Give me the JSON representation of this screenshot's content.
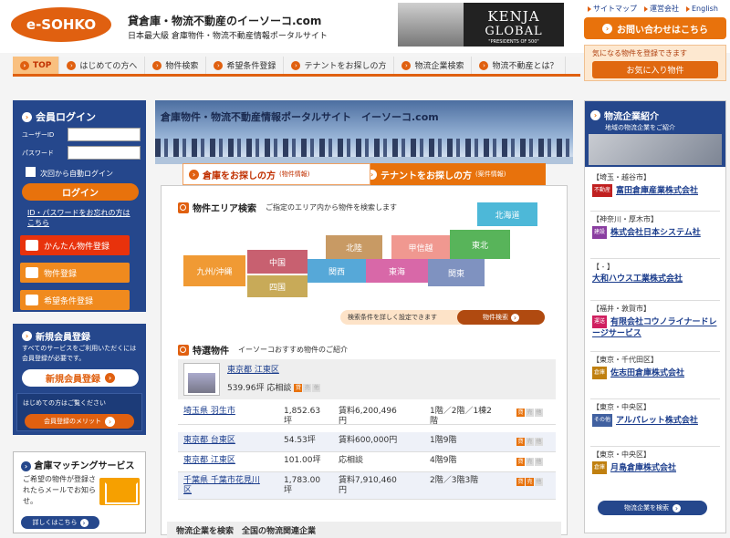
{
  "header": {
    "logo": "e-SOHKO",
    "title": "貸倉庫・物流不動産のイーソーコ.com",
    "subtitle": "日本最大級 倉庫物件・物流不動産情報ポータルサイト",
    "banner": {
      "line1": "KENJA",
      "line2": "GLOBAL",
      "line3": "\"PRESIDENTS OF 500\""
    },
    "toplinks": [
      "サイトマップ",
      "運営会社",
      "English"
    ],
    "contact": "お問い合わせはこちら",
    "fav_note": "気になる物件を登録できます",
    "fav_btn": "お気に入り物件"
  },
  "nav": [
    "TOP",
    "はじめての方へ",
    "物件検索",
    "希望条件登録",
    "テナントをお探しの方",
    "物流企業検索",
    "物流不動産とは？"
  ],
  "login": {
    "title": "会員ログイン",
    "user_label": "ユーザーID",
    "pass_label": "パスワード",
    "auto": "次回から自動ログイン",
    "button": "ログイン",
    "forgot": "ID・パスワードをお忘れの方はこちら"
  },
  "quick": [
    "かんたん物件登録",
    "物件登録",
    "希望条件登録"
  ],
  "register": {
    "title": "新規会員登録",
    "desc": "すべてのサービスをご利用いただくには会員登録が必要です。",
    "button": "新規会員登録",
    "first": "はじめての方はご覧ください",
    "merit": "会員登録のメリット"
  },
  "matching": {
    "title": "倉庫マッチングサービス",
    "desc": "ご希望の物件が登録されたらメールでお知らせ。",
    "button": "詳しくはこちら"
  },
  "hero": {
    "title": "倉庫物件・物流不動産情報ポータルサイト　イーソーコ.com"
  },
  "tabs": {
    "tab1": "倉庫をお探しの方",
    "tab1_small": "(物件情報)",
    "tab2": "テナントをお探しの方",
    "tab2_small": "(案件情報)"
  },
  "area": {
    "title": "物件エリア検索",
    "desc": "ご指定のエリア内から物件を検索します",
    "regions": [
      "北海道",
      "東北",
      "北陸",
      "甲信越",
      "中国",
      "関西",
      "東海",
      "関東",
      "九州/沖縄",
      "四国"
    ],
    "detail": "検索条件を詳しく設定できます",
    "button": "物件検索"
  },
  "featured": {
    "title": "特選物件",
    "desc": "イーソーコおすすめ物件のご紹介",
    "addr": "東京都 江東区",
    "area": "539.96坪 応相談"
  },
  "rows": [
    {
      "addr": "埼玉県 羽生市",
      "area": "1,852.63\n坪",
      "price": "賃料6,200,496\n円",
      "floor": "1階／2階／1棟2\n階"
    },
    {
      "addr": "東京都 台東区",
      "area": "54.53坪",
      "price": "賃料600,000円",
      "floor": "1階9階"
    },
    {
      "addr": "東京都 江東区",
      "area": "101.00坪",
      "price": "応相談",
      "floor": "4階9階"
    },
    {
      "addr": "千葉県 千葉市花見川\n区",
      "area": "1,783.00\n坪",
      "price": "賃料7,910,460\n円",
      "floor": "2階／3階3階"
    }
  ],
  "bottom": "物流企業を検索　全国の物流関連企業",
  "right": {
    "title": "物流企業紹介",
    "sub": "地域の物流企業をご紹介",
    "button": "物流企業を検索",
    "companies": [
      {
        "region": "【埼玉・越谷市】",
        "tag": "不動産",
        "tagcolor": "#c02020",
        "name": "富田倉庫産業株式会社"
      },
      {
        "region": "【神奈川・厚木市】",
        "tag": "建設",
        "tagcolor": "#8a3ea0",
        "name": "株式会社日本システム社"
      },
      {
        "region": "【 - 】",
        "tag": "",
        "tagcolor": "#ffffff",
        "name": "大和ハウス工業株式会社"
      },
      {
        "region": "【福井・敦賀市】",
        "tag": "運送",
        "tagcolor": "#d02060",
        "name": "有限会社コウノライナードレージサービス"
      },
      {
        "region": "【東京・千代田区】",
        "tag": "倉庫",
        "tagcolor": "#c08010",
        "name": "佐志田倉庫株式会社"
      },
      {
        "region": "【東京・中央区】",
        "tag": "その他",
        "tagcolor": "#4060a0",
        "name": "アルパレット株式会社"
      },
      {
        "region": "【東京・中央区】",
        "tag": "倉庫",
        "tagcolor": "#c08010",
        "name": "月島倉庫株式会社"
      }
    ]
  }
}
